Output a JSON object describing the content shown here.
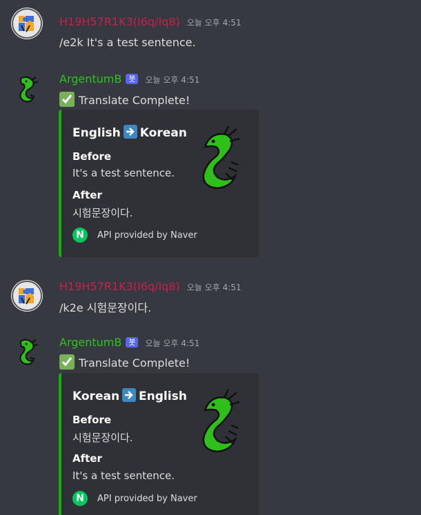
{
  "messages": [
    {
      "author": "H19H57R1K3(I6q/Iq8)",
      "timestamp": "오늘 오후 4:51",
      "text": "/e2k It's a test sentence."
    },
    {
      "author": "ArgentumB",
      "bot_tag": "봇",
      "timestamp": "오늘 오후 4:51",
      "text": "Translate Complete!",
      "embed": {
        "from": "English",
        "to": "Korean",
        "before_label": "Before",
        "before": "It's a test sentence.",
        "after_label": "After",
        "after": "시험문장이다.",
        "footer": "API provided by Naver",
        "footer_icon": "N"
      }
    },
    {
      "author": "H19H57R1K3(I6q/Iq8)",
      "timestamp": "오늘 오후 4:51",
      "text": "/k2e 시험문장이다."
    },
    {
      "author": "ArgentumB",
      "bot_tag": "봇",
      "timestamp": "오늘 오후 4:51",
      "text": "Translate Complete!",
      "embed": {
        "from": "Korean",
        "to": "English",
        "before_label": "Before",
        "before": "시험문장이다.",
        "after_label": "After",
        "after": "It's a test sentence.",
        "footer": "API provided by Naver",
        "footer_icon": "N"
      }
    }
  ],
  "colors": {
    "background": "#36393f",
    "embed_bg": "#2f3136",
    "embed_border": "#11b10d",
    "user_name": "#c81f4f",
    "bot_name": "#2ec320",
    "bot_tag": "#5865f2",
    "naver": "#03c75a"
  },
  "icons": {
    "user_avatar": "puzzle-piece-avatar-icon",
    "bot_avatar": "green-dragon-avatar-icon",
    "check": "check-mark-icon",
    "arrow": "right-arrow-icon",
    "embed_thumbnail": "green-dragon-icon"
  }
}
